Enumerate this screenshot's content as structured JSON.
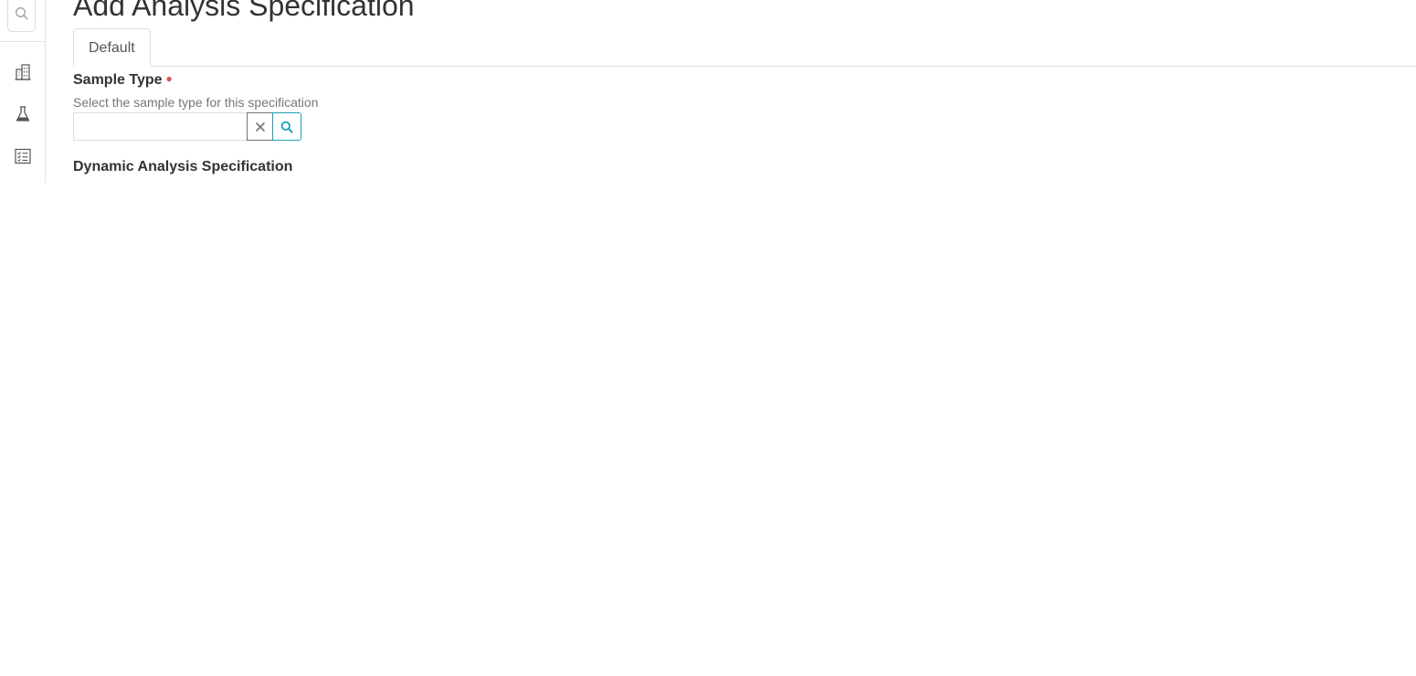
{
  "page": {
    "title": "Add Analysis Specification"
  },
  "tabs": [
    {
      "label": "Default",
      "active": true
    }
  ],
  "sample_type": {
    "label": "Sample Type",
    "required": true,
    "help": "Select the sample type for this specification",
    "value": "",
    "placeholder": ""
  },
  "dynamic_section": {
    "title": "Dynamic Analysis Specification"
  },
  "sidebar": {
    "items": [
      {
        "icon": "search-icon"
      },
      {
        "icon": "building-icon"
      },
      {
        "icon": "flask-icon"
      },
      {
        "icon": "checklist-icon"
      }
    ]
  },
  "colors": {
    "required": "#d9534f",
    "clear_button_border": "#6c757d",
    "search_button_border": "#17a2b8"
  }
}
